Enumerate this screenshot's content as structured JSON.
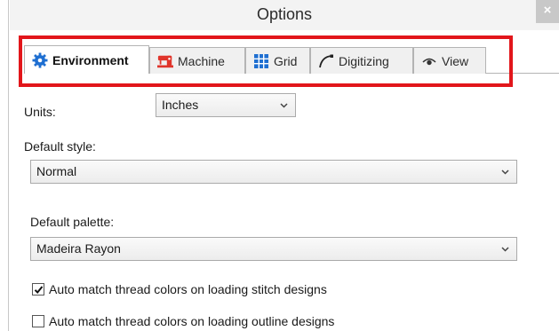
{
  "window": {
    "title": "Options",
    "close": "×"
  },
  "tabs": [
    {
      "label": "Environment",
      "icon": "gear-icon",
      "active": true
    },
    {
      "label": "Machine",
      "icon": "sewing-machine-icon",
      "active": false
    },
    {
      "label": "Grid",
      "icon": "grid-icon",
      "active": false
    },
    {
      "label": "Digitizing",
      "icon": "curve-pen-icon",
      "active": false
    },
    {
      "label": "View",
      "icon": "eye-icon",
      "active": false
    }
  ],
  "environment": {
    "units": {
      "label": "Units:",
      "value": "Inches"
    },
    "default_style": {
      "label": "Default style:",
      "value": "Normal"
    },
    "default_palette": {
      "label": "Default palette:",
      "value": "Madeira Rayon"
    },
    "auto_match_stitch": {
      "label": "Auto match thread colors on loading stitch designs",
      "checked": true
    },
    "auto_match_outline": {
      "label": "Auto match thread colors on loading outline designs",
      "checked": false
    }
  },
  "colors": {
    "highlight": "#e2161b",
    "gear": "#1f6fd1",
    "machine": "#e0352b",
    "grid": "#1f6fd1"
  }
}
